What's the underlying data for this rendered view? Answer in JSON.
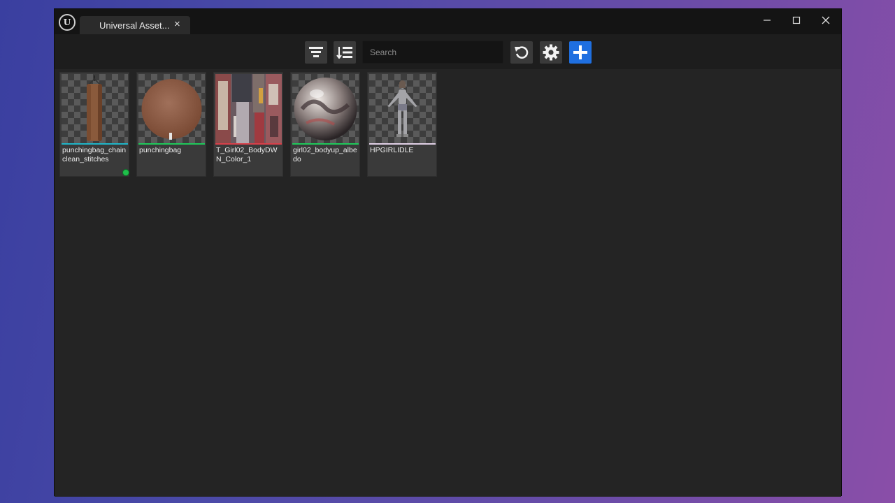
{
  "window": {
    "tab_label": "Universal Asset...",
    "tab_close": "×"
  },
  "toolbar": {
    "search_placeholder": "Search",
    "add_color": "#1f6fe0"
  },
  "assets": [
    {
      "name": "punchingbag_chainclean_stitches",
      "stripe_color": "#1fb5c8",
      "thumb": "punching-bag",
      "badge": true
    },
    {
      "name": "punchingbag",
      "stripe_color": "#1fc85a",
      "thumb": "leather-disc",
      "badge": false
    },
    {
      "name": "T_Girl02_BodyDWN_Color_1",
      "stripe_color": "#d8404a",
      "thumb": "texture-atlas",
      "badge": false
    },
    {
      "name": "girl02_bodyup_albedo",
      "stripe_color": "#1fc85a",
      "thumb": "material-sphere",
      "badge": false
    },
    {
      "name": "HPGIRLIDLE",
      "stripe_color": "#e0d0e6",
      "thumb": "character-model",
      "badge": false
    }
  ]
}
